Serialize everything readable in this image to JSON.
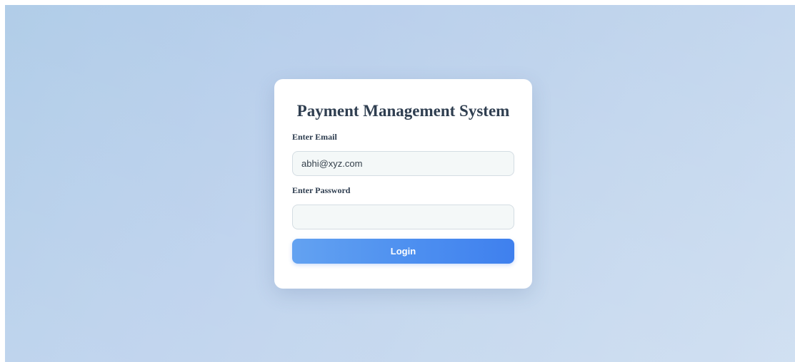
{
  "login": {
    "title": "Payment Management System",
    "email_label": "Enter Email",
    "email_value": "abhi@xyz.com",
    "password_label": "Enter Password",
    "password_value": "",
    "login_label": "Login"
  },
  "colors": {
    "background_start": "#a9c8e6",
    "background_end": "#cbdcf0",
    "card": "#ffffff",
    "title_text": "#2f3e50",
    "input_background": "#f4f8f8",
    "input_border": "#d4dde3",
    "button_start": "#63a2f1",
    "button_end": "#3f80ee",
    "button_text": "#ffffff"
  }
}
